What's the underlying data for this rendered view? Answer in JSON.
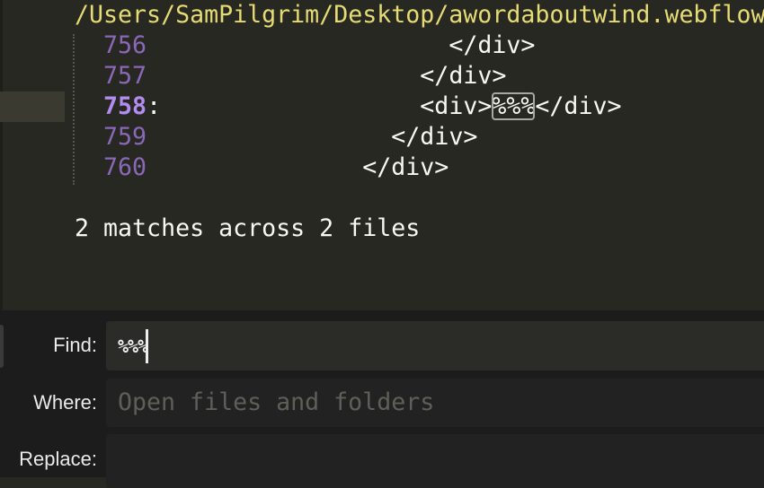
{
  "results": {
    "file_path": "/Users/SamPilgrim/Desktop/awordaboutwind.webflow",
    "lines": [
      {
        "number": "756",
        "indent": "                    ",
        "pre": "</div>",
        "match": "",
        "post": "",
        "current": false
      },
      {
        "number": "757",
        "indent": "                  ",
        "pre": "</div>",
        "match": "",
        "post": "",
        "current": false
      },
      {
        "number": "758",
        "indent": "                  ",
        "pre": "<div>",
        "match": "%%%",
        "post": "</div>",
        "current": true
      },
      {
        "number": "759",
        "indent": "                ",
        "pre": "</div>",
        "match": "",
        "post": "",
        "current": false
      },
      {
        "number": "760",
        "indent": "              ",
        "pre": "</div>",
        "match": "",
        "post": "",
        "current": false
      }
    ],
    "summary": "2 matches across 2 files"
  },
  "find_panel": {
    "find_label": "Find:",
    "find_value": "%%%",
    "where_label": "Where:",
    "where_placeholder": "Open files and folders",
    "where_value": "",
    "replace_label": "Replace:",
    "replace_value": ""
  },
  "colors": {
    "background": "#272822",
    "path": "#e6db74",
    "line_number": "#8a68b8",
    "current_line_number": "#b28cf0",
    "panel": "#1c1c1c"
  }
}
